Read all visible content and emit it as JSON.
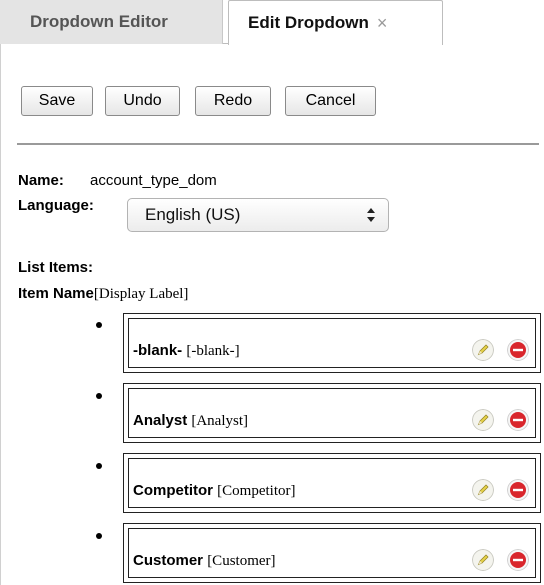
{
  "tabs": [
    {
      "label": "Dropdown Editor"
    },
    {
      "label": "Edit Dropdown",
      "close": "×"
    }
  ],
  "toolbar": {
    "save": "Save",
    "undo": "Undo",
    "redo": "Redo",
    "cancel": "Cancel"
  },
  "form": {
    "name_label": "Name:",
    "name_value": "account_type_dom",
    "language_label": "Language:",
    "language_value": "English (US)",
    "list_items_label": "List Items:",
    "item_name_header": "Item Name",
    "display_label_header": "[Display Label]"
  },
  "items": [
    {
      "name": "-blank-",
      "display": "[-blank-]"
    },
    {
      "name": "Analyst",
      "display": "[Analyst]"
    },
    {
      "name": "Competitor",
      "display": "[Competitor]"
    },
    {
      "name": "Customer",
      "display": "[Customer]"
    }
  ],
  "icons": {
    "edit": "pencil-icon",
    "delete": "minus-circle-icon"
  },
  "colors": {
    "delete_red": "#d9262c",
    "edit_yellow": "#e8d44a"
  }
}
